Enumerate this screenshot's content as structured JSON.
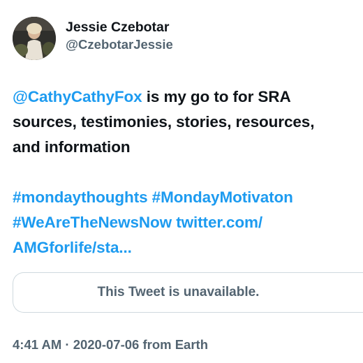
{
  "author": {
    "display_name": "Jessie Czebotar",
    "handle": "@CzebotarJessie"
  },
  "tweet": {
    "mention": "@CathyCathyFox",
    "line1_rest": " is my go to for SRA",
    "line2": "sources, testimonies, stories, resources,",
    "line3": "and information",
    "hashtag1": "#mondaythoughts",
    "hashtag2": "#MondayMotivaton",
    "hashtag3": "#WeAreTheNewsNow",
    "link_part1": "twitter.com/",
    "link_part2": "AMGforlife/sta..."
  },
  "quoted_tweet": {
    "status_text": "This Tweet is unavailable."
  },
  "meta": {
    "timestamp": "4:41 AM · 2020-07-06 from Earth"
  },
  "colors": {
    "link": "#1d9bf0",
    "primary_text": "#0f1419",
    "secondary_text": "#536471",
    "border": "#cfd9de"
  }
}
